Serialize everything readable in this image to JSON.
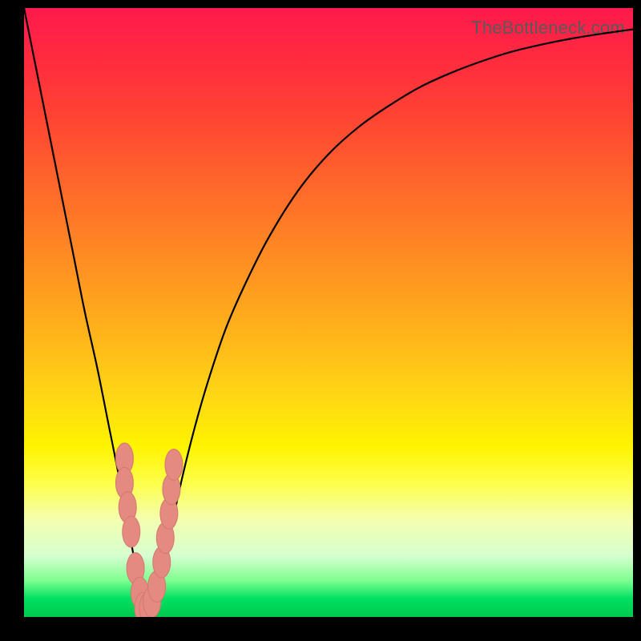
{
  "watermark": "TheBottleneck.com",
  "colors": {
    "curve_stroke": "#000000",
    "marker_fill": "#e58a80",
    "marker_stroke": "#d47a70"
  },
  "chart_data": {
    "type": "line",
    "title": "",
    "xlabel": "",
    "ylabel": "",
    "xlim": [
      0,
      100
    ],
    "ylim": [
      0,
      100
    ],
    "series": [
      {
        "name": "bottleneck-curve",
        "x": [
          0,
          2,
          4,
          6,
          8,
          10,
          12,
          14,
          16,
          18,
          19,
          20,
          21,
          22,
          24,
          26,
          28,
          30,
          33,
          36,
          40,
          45,
          50,
          55,
          60,
          65,
          70,
          75,
          80,
          85,
          90,
          95,
          100
        ],
        "y": [
          100,
          90,
          80,
          70,
          60,
          50,
          41,
          31,
          21,
          10,
          5,
          1,
          2,
          6,
          14,
          23,
          31,
          38,
          47,
          54,
          62,
          70,
          76,
          80.5,
          84,
          87,
          89.3,
          91.2,
          92.8,
          94,
          95,
          95.8,
          96.5
        ]
      }
    ],
    "markers": [
      {
        "x": 16.5,
        "y": 26,
        "r": 1.6
      },
      {
        "x": 16.5,
        "y": 22,
        "r": 1.6
      },
      {
        "x": 17.0,
        "y": 18,
        "r": 1.6
      },
      {
        "x": 17.6,
        "y": 14,
        "r": 1.6
      },
      {
        "x": 18.3,
        "y": 8,
        "r": 1.6
      },
      {
        "x": 19.0,
        "y": 4,
        "r": 1.6
      },
      {
        "x": 19.6,
        "y": 1.5,
        "r": 1.6
      },
      {
        "x": 20.4,
        "y": 1.5,
        "r": 1.6
      },
      {
        "x": 21.0,
        "y": 2.5,
        "r": 1.6
      },
      {
        "x": 21.8,
        "y": 5,
        "r": 1.6
      },
      {
        "x": 22.6,
        "y": 9,
        "r": 1.6
      },
      {
        "x": 23.2,
        "y": 13,
        "r": 1.6
      },
      {
        "x": 23.8,
        "y": 17,
        "r": 1.6
      },
      {
        "x": 24.2,
        "y": 21,
        "r": 1.6
      },
      {
        "x": 24.6,
        "y": 25,
        "r": 1.6
      }
    ]
  }
}
